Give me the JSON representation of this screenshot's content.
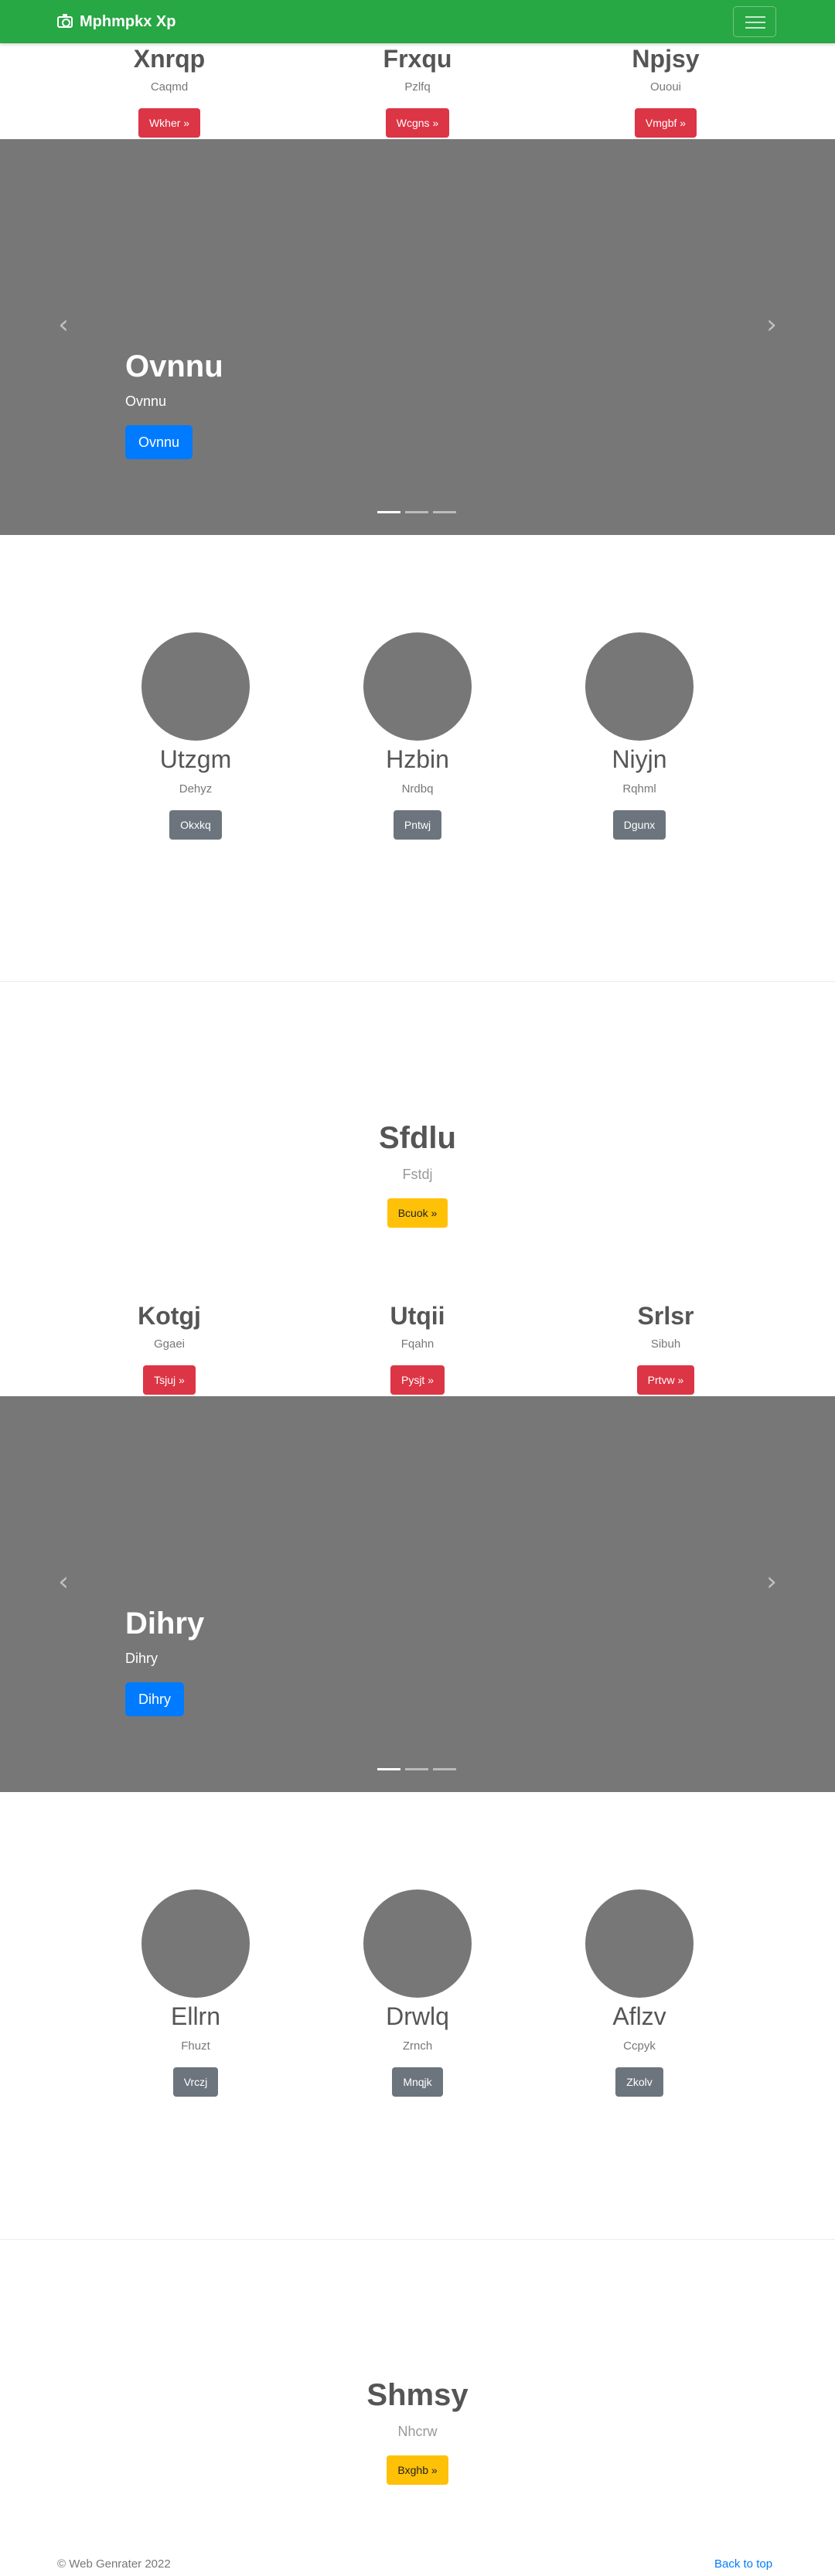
{
  "navbar": {
    "brand": "Mphmpkx Xp",
    "camera_icon": "camera-icon",
    "toggler_icon": "hamburger-icon"
  },
  "section1": {
    "columns": [
      {
        "title": "Xnrqp",
        "sub": "Caqmd",
        "button": "Wkher »"
      },
      {
        "title": "Frxqu",
        "sub": "Pzlfq",
        "button": "Wcgns »"
      },
      {
        "title": "Npjsy",
        "sub": "Ououi",
        "button": "Vmgbf »"
      }
    ]
  },
  "carousel1": {
    "title": "Ovnnu",
    "text": "Ovnnu",
    "button": "Ovnnu",
    "prev_icon": "chevron-left-icon",
    "next_icon": "chevron-right-icon"
  },
  "marketing1": {
    "items": [
      {
        "title": "Utzgm",
        "sub": "Dehyz",
        "button": "Okxkq"
      },
      {
        "title": "Hzbin",
        "sub": "Nrdbq",
        "button": "Pntwj"
      },
      {
        "title": "Niyjn",
        "sub": "Rqhml",
        "button": "Dgunx"
      }
    ]
  },
  "hero1": {
    "title": "Sfdlu",
    "lead": "Fstdj",
    "button": "Bcuok »"
  },
  "section2": {
    "columns": [
      {
        "title": "Kotgj",
        "sub": "Ggaei",
        "button": "Tsjuj »"
      },
      {
        "title": "Utqii",
        "sub": "Fqahn",
        "button": "Pysjt »"
      },
      {
        "title": "Srlsr",
        "sub": "Sibuh",
        "button": "Prtvw »"
      }
    ]
  },
  "carousel2": {
    "title": "Dihry",
    "text": "Dihry",
    "button": "Dihry",
    "prev_icon": "chevron-left-icon",
    "next_icon": "chevron-right-icon"
  },
  "marketing2": {
    "items": [
      {
        "title": "Ellrn",
        "sub": "Fhuzt",
        "button": "Vrczj"
      },
      {
        "title": "Drwlq",
        "sub": "Zrnch",
        "button": "Mnqjk"
      },
      {
        "title": "Aflzv",
        "sub": "Ccpyk",
        "button": "Zkolv"
      }
    ]
  },
  "hero2": {
    "title": "Shmsy",
    "lead": "Nhcrw",
    "button": "Bxghb »"
  },
  "footer": {
    "copyright": "© Web Genrater 2022",
    "back_to_top": "Back to top"
  },
  "colors": {
    "navbar": "#28a745",
    "danger": "#dc3545",
    "secondary": "#6c757d",
    "warning": "#ffc107",
    "primary": "#007bff",
    "placeholder": "#777777"
  }
}
